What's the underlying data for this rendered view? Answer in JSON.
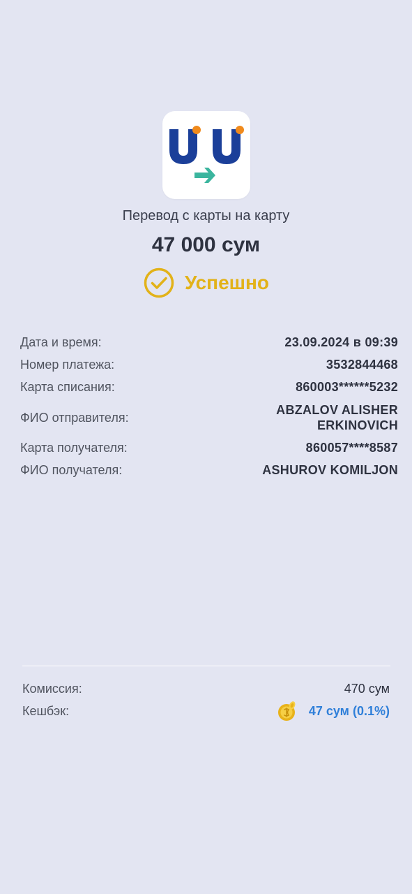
{
  "header": {
    "title": "Перевод с карты на карту",
    "amount": "47 000 сум",
    "status": "Успешно"
  },
  "details": {
    "date_label": "Дата и время:",
    "date_value": "23.09.2024 в 09:39",
    "payment_number_label": "Номер платежа:",
    "payment_number_value": "3532844468",
    "debit_card_label": "Карта списания:",
    "debit_card_value": "860003******5232",
    "sender_label": "ФИО отправителя:",
    "sender_value_line1": "ABZALOV ALISHER",
    "sender_value_line2": "ERKINOVICH",
    "recipient_card_label": "Карта получателя:",
    "recipient_card_value": "860057****8587",
    "recipient_label": "ФИО получателя:",
    "recipient_value": "ASHUROV KOMILJON"
  },
  "fees": {
    "commission_label": "Комиссия:",
    "commission_value": "470 сум",
    "cashback_label": "Кешбэк:",
    "cashback_value": "47 сум (0.1%)"
  },
  "icons": {
    "logo": "uzcard-transfer-logo",
    "status": "check-circle-icon",
    "cashback": "coin-icon"
  },
  "colors": {
    "background": "#e3e5f2",
    "success": "#e2b219",
    "cashback": "#2f7fd9",
    "brand_blue": "#1b3f99",
    "brand_orange": "#f08a1c",
    "brand_teal": "#3bb59e"
  }
}
